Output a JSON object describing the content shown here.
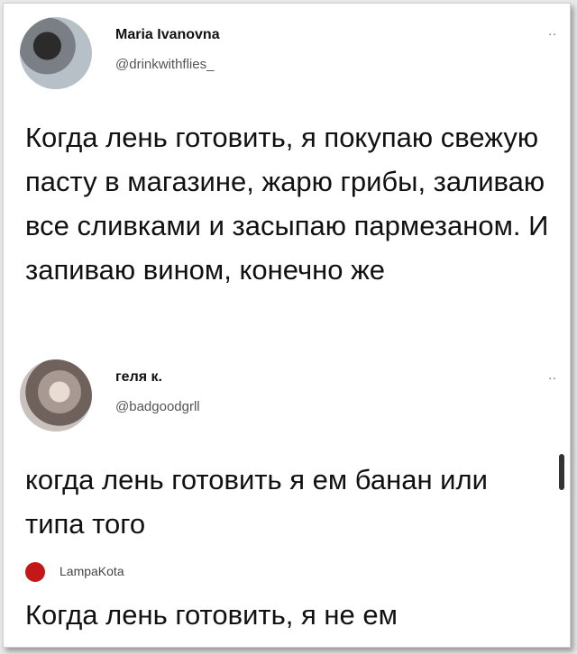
{
  "tweets": [
    {
      "name": "Maria Ivanovna",
      "handle": "@drinkwithflies_",
      "more": "..",
      "text": "Когда лень готовить, я покупаю свежую пасту в магазине, жарю грибы, заливаю все сливками и засыпаю пармезаном. И запиваю вином, конечно же"
    },
    {
      "name": "геля к.",
      "handle": "@badgoodgrll",
      "more": "..",
      "text": "когда лень готовить я ем банан или типа того"
    }
  ],
  "third": {
    "label": "LampaKota",
    "text": "Когда лень готовить, я не ем"
  }
}
